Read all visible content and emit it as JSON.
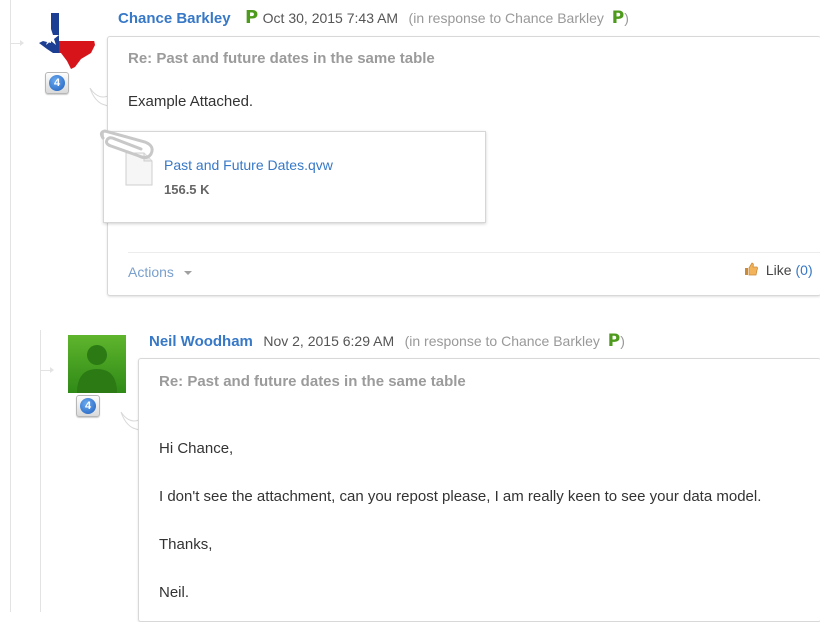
{
  "post1": {
    "author": "Chance Barkley",
    "badge": "P",
    "date": "Oct 30, 2015 7:43 AM",
    "in_response_prefix": "(in response to",
    "in_response_name": "Chance Barkley",
    "in_response_badge": "P",
    "in_response_suffix": ")",
    "rank": "4",
    "title": "Re: Past and future dates in the same table",
    "body": "Example Attached.",
    "attachment": {
      "file_name": "Past and Future Dates.qvw",
      "file_size": "156.5 K"
    },
    "actions_label": "Actions",
    "like_label": "Like",
    "like_open": "(",
    "like_count": "0",
    "like_close": ")"
  },
  "post2": {
    "author": "Neil Woodham",
    "date": "Nov 2, 2015 6:29 AM",
    "in_response_prefix": "(in response to",
    "in_response_name": "Chance Barkley",
    "in_response_badge": "P",
    "in_response_suffix": ")",
    "rank": "4",
    "title": "Re: Past and future dates in the same table",
    "body_lines": [
      "Hi Chance,",
      "I don't see the attachment, can you repost please, I am really keen to see your data model.",
      "Thanks,",
      "Neil."
    ]
  },
  "colors": {
    "link": "#3778c7",
    "badge_green": "#4d9a1c",
    "muted": "#999999"
  },
  "icons": [
    "texas-flag-avatar",
    "rank-badge-icon",
    "paperclip-icon",
    "document-icon",
    "chevron-down-icon",
    "thumbs-up-icon",
    "default-user-avatar"
  ]
}
